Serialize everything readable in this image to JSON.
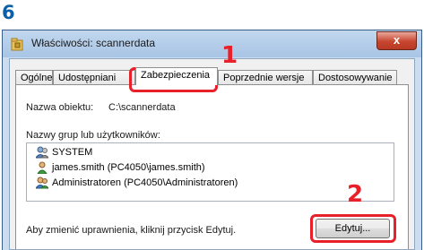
{
  "step": "6",
  "window": {
    "title": "Właściwości: scannerdata",
    "close_glyph": "x"
  },
  "tabs": [
    {
      "label": "Ogólne",
      "active": false
    },
    {
      "label": "Udostępniani",
      "active": false
    },
    {
      "label": "Zabezpieczenia",
      "active": true
    },
    {
      "label": "Poprzednie wersje",
      "active": false
    },
    {
      "label": "Dostosowywanie",
      "active": false
    }
  ],
  "security": {
    "object_name_label": "Nazwa obiektu:",
    "object_name_value": "C:\\scannerdata",
    "groups_label": "Nazwy grup lub użytkowników:",
    "groups": [
      {
        "name": "SYSTEM",
        "icon": "user-group-icon"
      },
      {
        "name": "james.smith (PC4050\\james.smith)",
        "icon": "user-icon"
      },
      {
        "name": "Administratoren (PC4050\\Administratoren)",
        "icon": "user-group-icon"
      }
    ],
    "change_hint": "Aby zmienić uprawnienia, kliknij przycisk Edytuj.",
    "edit_button": "Edytuj..."
  },
  "callouts": [
    {
      "number": "1",
      "color": "#e8202a"
    },
    {
      "number": "2",
      "color": "#e8202a"
    }
  ],
  "colors": {
    "step_number": "#0a5fa8",
    "callout": "#e8202a",
    "window_frame": "#c9dcf0",
    "close_button": "#c8452e"
  }
}
